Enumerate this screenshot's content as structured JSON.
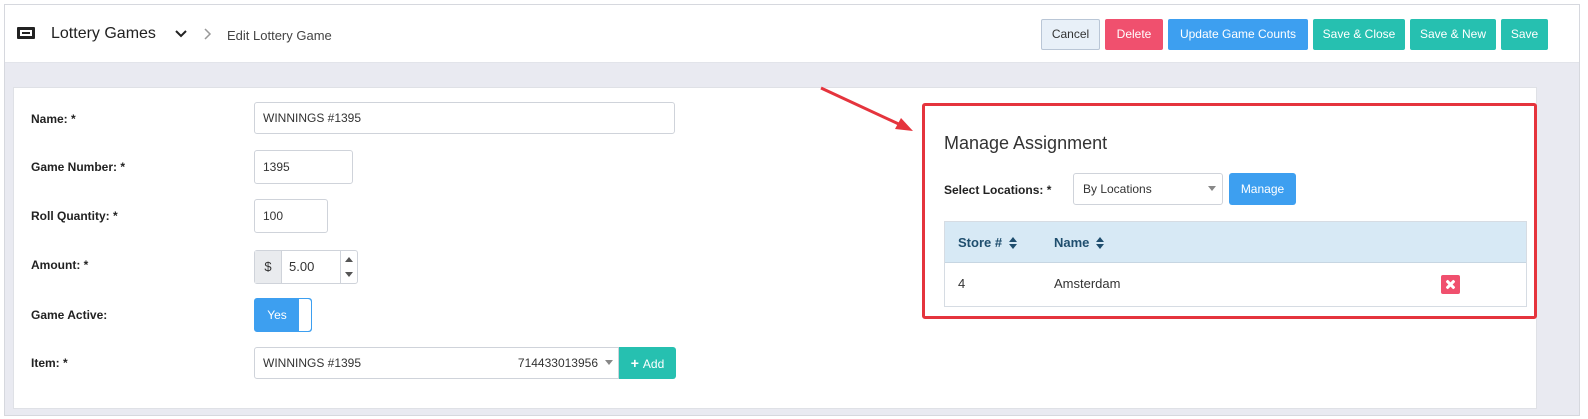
{
  "header": {
    "title": "Lottery Games",
    "breadcrumb": "Edit Lottery Game",
    "icon": "ticket-icon"
  },
  "toolbar": {
    "cancel_label": "Cancel",
    "delete_label": "Delete",
    "update_label": "Update Game Counts",
    "save_close_label": "Save & Close",
    "save_new_label": "Save & New",
    "save_label": "Save"
  },
  "form": {
    "name": {
      "label": "Name: *",
      "value": "WINNINGS #1395"
    },
    "game_number": {
      "label": "Game Number: *",
      "value": "1395"
    },
    "roll_quantity": {
      "label": "Roll Quantity: *",
      "value": "100"
    },
    "amount": {
      "label": "Amount: *",
      "currency": "$",
      "value": "5.00"
    },
    "game_active": {
      "label": "Game Active:",
      "value": "Yes"
    },
    "item": {
      "label": "Item: *",
      "name": "WINNINGS #1395",
      "code": "714433013956",
      "add_label": "Add"
    }
  },
  "assignment": {
    "title": "Manage Assignment",
    "select_label": "Select Locations: *",
    "select_value": "By Locations",
    "manage_label": "Manage",
    "columns": [
      "Store #",
      "Name"
    ],
    "rows": [
      {
        "store": "4",
        "name": "Amsterdam"
      }
    ]
  },
  "colors": {
    "primary": "#3d9ff0",
    "teal": "#26c0b0",
    "danger": "#f0506e",
    "highlight": "#e5343d"
  }
}
